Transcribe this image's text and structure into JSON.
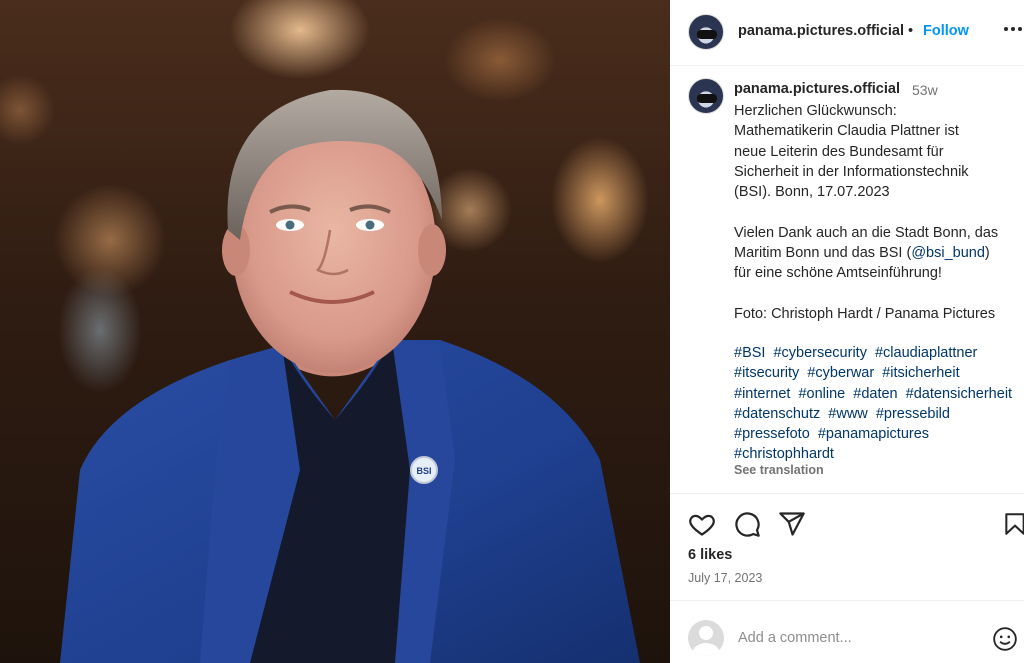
{
  "post": {
    "username": "panama.pictures.official",
    "separator": "•",
    "follow_label": "Follow",
    "more_label": "•••",
    "time_ago": "53w",
    "caption_text": "Herzlichen Glückwunsch:\nMathematikerin Claudia Plattner ist\nneue Leiterin des Bundesamt für\nSicherheit in der Informationstechnik\n(BSI). Bonn, 17.07.2023\n\nVielen Dank auch an die Stadt Bonn, das\nMaritim Bonn und das BSI (",
    "mention": "@bsi_bund",
    "caption_after_mention": ")\nfür eine schöne Amtseinführung!\n\nFoto: Christoph Hardt / Panama Pictures",
    "hashtags": [
      "#BSI",
      "#cybersecurity",
      "#claudiaplattner",
      "#itsecurity",
      "#cyberwar",
      "#itsicherheit",
      "#internet",
      "#online",
      "#daten",
      "#datensicherheit",
      "#datenschutz",
      "#www",
      "#pressebild",
      "#pressefoto",
      "#panamapictures",
      "#christophhardt"
    ],
    "see_translation": "See translation",
    "likes": "6 likes",
    "date": "July 17, 2023",
    "pin_text": "BSI"
  },
  "comment": {
    "placeholder": "Add a comment..."
  },
  "icons": {
    "like": "heart-icon",
    "comment": "comment-icon",
    "share": "share-icon",
    "save": "bookmark-icon",
    "emoji": "emoji-icon",
    "more": "more-options-icon"
  },
  "colors": {
    "follow": "#0095f6",
    "hashtag": "#00376b",
    "secondary_text": "#737373",
    "jacket": "#1f3f8f"
  }
}
